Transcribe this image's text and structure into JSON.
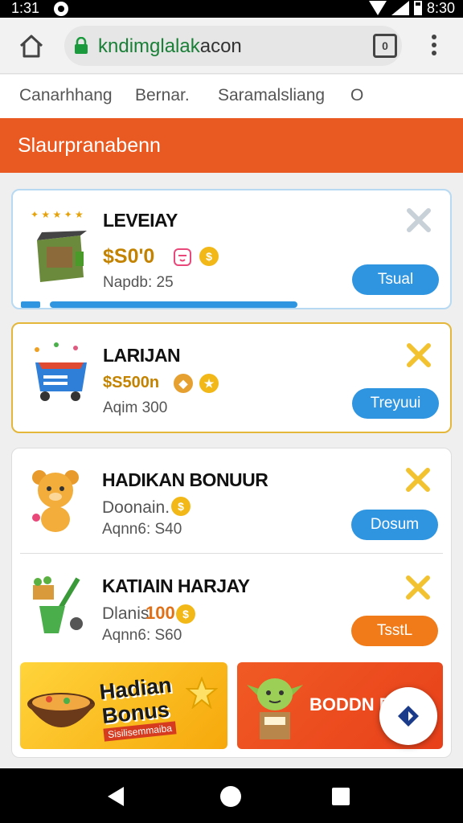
{
  "status_bar": {
    "time": "1:31",
    "clock": "8:30"
  },
  "browser": {
    "url_host": "kndimglalak",
    "url_rest": "acon",
    "tabs_count": "0"
  },
  "nav": {
    "items": [
      "Canarhhang",
      "Bernar.",
      "Saramalsliang",
      "O"
    ]
  },
  "header": {
    "title": "Slaurpranabenn"
  },
  "items": [
    {
      "title": "LEVEIAY",
      "price": "$S0'0",
      "sub": "Napdb: 25",
      "action": "Tsual"
    },
    {
      "title": "LARIJAN",
      "price": "$S500n",
      "sub": "Aqim 300",
      "action": "Treyuui"
    },
    {
      "title": "HADIKAN BONUUR",
      "price": "Doonain.",
      "sub": "Aqnn6: S40",
      "action": "Dosum"
    },
    {
      "title": "KATIAIN HARJAY",
      "price_label": "Dlanis",
      "price": "100",
      "sub": "Aqnn6: S60",
      "action": "TsstL"
    }
  ],
  "banners": {
    "left_title": "Hadian Bonus",
    "left_small": "Sisilisemmaiba",
    "right_title": "BODDN D"
  },
  "colors": {
    "accent_orange": "#e95a22",
    "button_blue": "#2f95e0",
    "button_orange": "#f07b18",
    "gold": "#c38300"
  }
}
